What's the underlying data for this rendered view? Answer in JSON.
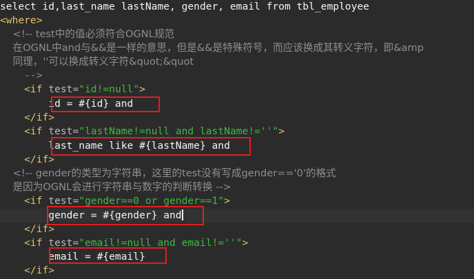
{
  "editor": {
    "lines": [
      [
        {
          "t": "select id,last_name lastName, gender, email from tbl_employee",
          "c": "plain"
        }
      ],
      [
        {
          "t": "<where>",
          "c": "tag"
        }
      ],
      [
        {
          "t": "    <!-- test中的值必须符合OGNL规范",
          "c": "com"
        }
      ],
      [
        {
          "t": "    在OGNL中and与&&是一样的意思，但是&&是特殊符号，而应该换成其转义字符，即&amp",
          "c": "com"
        }
      ],
      [
        {
          "t": "    同理，''可以换成转义字符&quot;&quot",
          "c": "com"
        }
      ],
      [
        {
          "t": "    -->",
          "c": "com"
        }
      ],
      [
        {
          "t": "    <if ",
          "c": "tag"
        },
        {
          "t": "test=",
          "c": "attr"
        },
        {
          "t": "\"id!=null\"",
          "c": "val"
        },
        {
          "t": ">",
          "c": "tag"
        }
      ],
      [
        {
          "t": "        id = #{id} and",
          "c": "plain"
        }
      ],
      [
        {
          "t": "    </if>",
          "c": "tag"
        }
      ],
      [
        {
          "t": "    <if ",
          "c": "tag"
        },
        {
          "t": "test=",
          "c": "attr"
        },
        {
          "t": "\"lastName!=null and lastName!=''\"",
          "c": "val"
        },
        {
          "t": ">",
          "c": "tag"
        }
      ],
      [
        {
          "t": "        last_name like #{lastName} and",
          "c": "plain"
        }
      ],
      [
        {
          "t": "    </if>",
          "c": "tag"
        }
      ],
      [
        {
          "t": "    <!-- gender的类型为字符串，这里的test没有写成gender=='0'的格式",
          "c": "com"
        }
      ],
      [
        {
          "t": "    是因为OGNL会进行字符串与数字的判断转换 -->",
          "c": "com"
        }
      ],
      [
        {
          "t": "    <if ",
          "c": "tag"
        },
        {
          "t": "test=",
          "c": "attr"
        },
        {
          "t": "\"gender==0 or gender==1\"",
          "c": "val"
        },
        {
          "t": ">",
          "c": "tag"
        }
      ],
      [
        {
          "t": "        gender = #{gender} and",
          "c": "plain"
        }
      ],
      [
        {
          "t": "    </if>",
          "c": "tag"
        }
      ],
      [
        {
          "t": "    <if ",
          "c": "tag"
        },
        {
          "t": "test=",
          "c": "attr"
        },
        {
          "t": "\"email!=null and email!=''\"",
          "c": "val"
        },
        {
          "t": ">",
          "c": "tag"
        }
      ],
      [
        {
          "t": "        email = #{email}",
          "c": "plain"
        }
      ],
      [
        {
          "t": "    </if>",
          "c": "tag"
        }
      ]
    ]
  },
  "colors": {
    "background": "#2b2b2b",
    "plain": "#f4f4f4",
    "tag": "#e8bf6a",
    "attribute": "#bababa",
    "string": "#3fb93f",
    "comment": "#8f8f8f",
    "highlight_box": "#e02020"
  }
}
